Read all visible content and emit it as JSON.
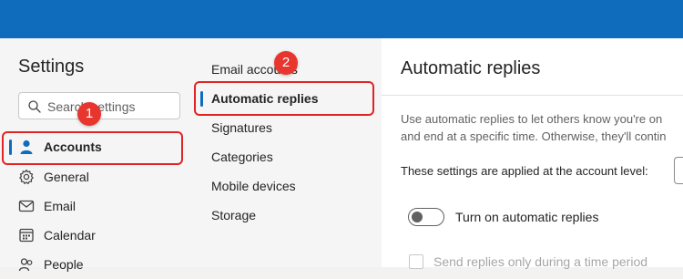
{
  "settings_panel": {
    "title": "Settings",
    "search": {
      "placeholder": "Search settings"
    },
    "nav_items": [
      {
        "label": "Accounts",
        "icon": "person-icon",
        "selected": true
      },
      {
        "label": "General",
        "icon": "gear-icon"
      },
      {
        "label": "Email",
        "icon": "mail-icon"
      },
      {
        "label": "Calendar",
        "icon": "calendar-icon"
      },
      {
        "label": "People",
        "icon": "people-icon"
      }
    ]
  },
  "accounts_submenu": {
    "items": [
      {
        "label": "Email accounts"
      },
      {
        "label": "Automatic replies",
        "selected": true
      },
      {
        "label": "Signatures"
      },
      {
        "label": "Categories"
      },
      {
        "label": "Mobile devices"
      },
      {
        "label": "Storage"
      }
    ]
  },
  "automatic_replies": {
    "title": "Automatic replies",
    "description_line1": "Use automatic replies to let others know you're on",
    "description_line2": "and end at a specific time. Otherwise, they'll contin",
    "account_level_label": "These settings are applied at the account level:",
    "toggle_label": "Turn on automatic replies",
    "toggle_on": false,
    "time_period_label": "Send replies only during a time period",
    "time_period_checked": false
  },
  "callouts": [
    {
      "number": "1"
    },
    {
      "number": "2"
    }
  ],
  "colors": {
    "topbar": "#0f6cbd",
    "accent": "#0f6cbd",
    "callout_red": "#e02424"
  }
}
